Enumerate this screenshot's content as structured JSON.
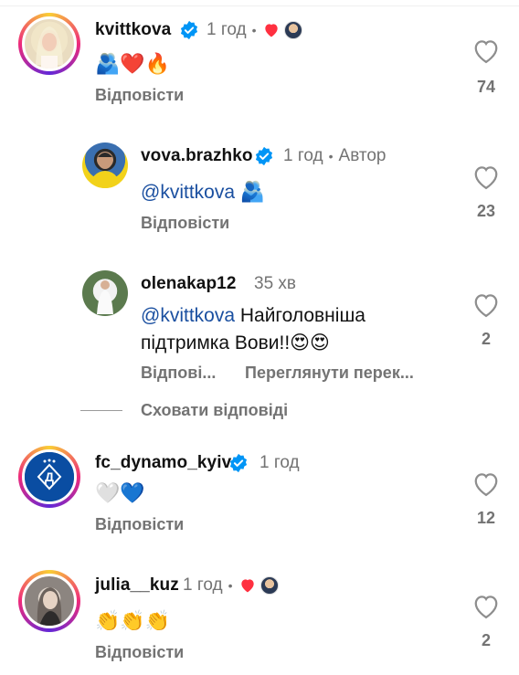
{
  "comments": [
    {
      "username": "kvittkova",
      "time": "1 год",
      "text": "🫂❤️🔥",
      "reply_label": "Відповісти",
      "likes": "74",
      "verified": true,
      "author_liked": true
    },
    {
      "username": "vova.brazhko",
      "time": "1 год",
      "author_tag": "Автор",
      "mention": "@kvittkova",
      "text": "🫂",
      "reply_label": "Відповісти",
      "likes": "23",
      "verified": true
    },
    {
      "username": "olenakap12",
      "time": "35 хв",
      "mention": "@kvittkova",
      "text_line1": "Найголовніша",
      "text_line2": "підтримка Вови!!😍😍",
      "reply_label": "Відпові...",
      "see_translation": "Переглянути перек...",
      "likes": "2"
    },
    {
      "username": "fc_dynamo_kyiv",
      "time": "1 год",
      "text": "🤍💙",
      "reply_label": "Відповісти",
      "likes": "12",
      "verified": true
    },
    {
      "username": "julia__kuz",
      "time": "1 год",
      "text": "👏👏👏",
      "reply_label": "Відповісти",
      "likes": "2",
      "author_liked": true
    }
  ],
  "hide_replies": "Сховати відповіді",
  "colors": {
    "verified_blue": "#0095f6",
    "heart_red": "#ff3040",
    "muted": "#737373",
    "mention": "#1a4fa0",
    "dynamo_blue": "#0a4da2"
  },
  "icons": {
    "like": "heart-outline-icon",
    "verified": "verified-badge-icon",
    "author_liked": "red-heart-icon"
  }
}
